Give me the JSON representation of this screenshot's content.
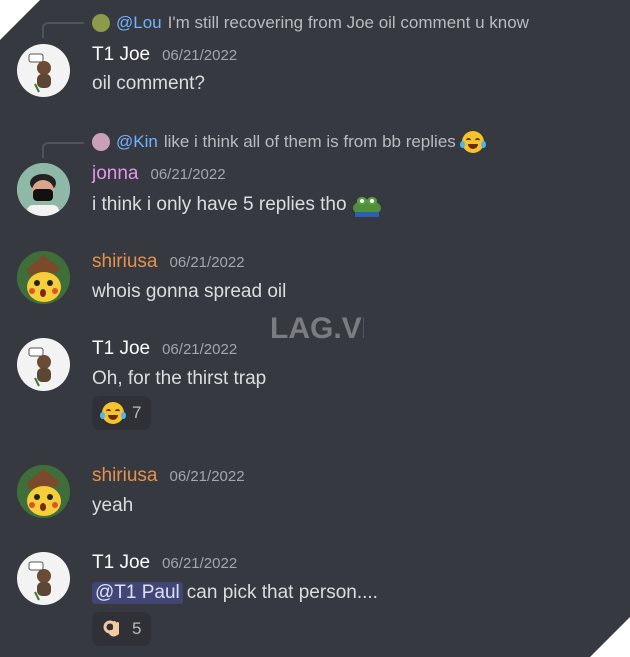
{
  "messages": [
    {
      "reply": {
        "mention": "@Lou",
        "text": "I'm still recovering from Joe oil comment u know"
      },
      "author": "T1 Joe",
      "timestamp": "06/21/2022",
      "text": "oil comment?"
    },
    {
      "reply": {
        "mention": "@Kin",
        "text": "like i think all of them is from bb replies"
      },
      "author": "jonna",
      "timestamp": "06/21/2022",
      "text": "i think i only have 5 replies tho"
    },
    {
      "author": "shiriusa",
      "timestamp": "06/21/2022",
      "text": "whois gonna spread oil"
    },
    {
      "author": "T1 Joe",
      "timestamp": "06/21/2022",
      "text": "Oh, for the thirst trap",
      "reaction": {
        "emoji": "joy-face",
        "count": "7"
      }
    },
    {
      "author": "shiriusa",
      "timestamp": "06/21/2022",
      "text": "yeah"
    },
    {
      "author": "T1 Joe",
      "timestamp": "06/21/2022",
      "mention": "@T1 Paul",
      "text": "can pick that person....",
      "reaction": {
        "emoji": "ok-hand",
        "count": "5"
      }
    }
  ],
  "watermark": "LAG.VN",
  "colors": {
    "background": "#36393f",
    "joe": "#ffffff",
    "jonna": "#e495e8",
    "shiriusa": "#e8914c",
    "mention_bg": "#414675"
  }
}
